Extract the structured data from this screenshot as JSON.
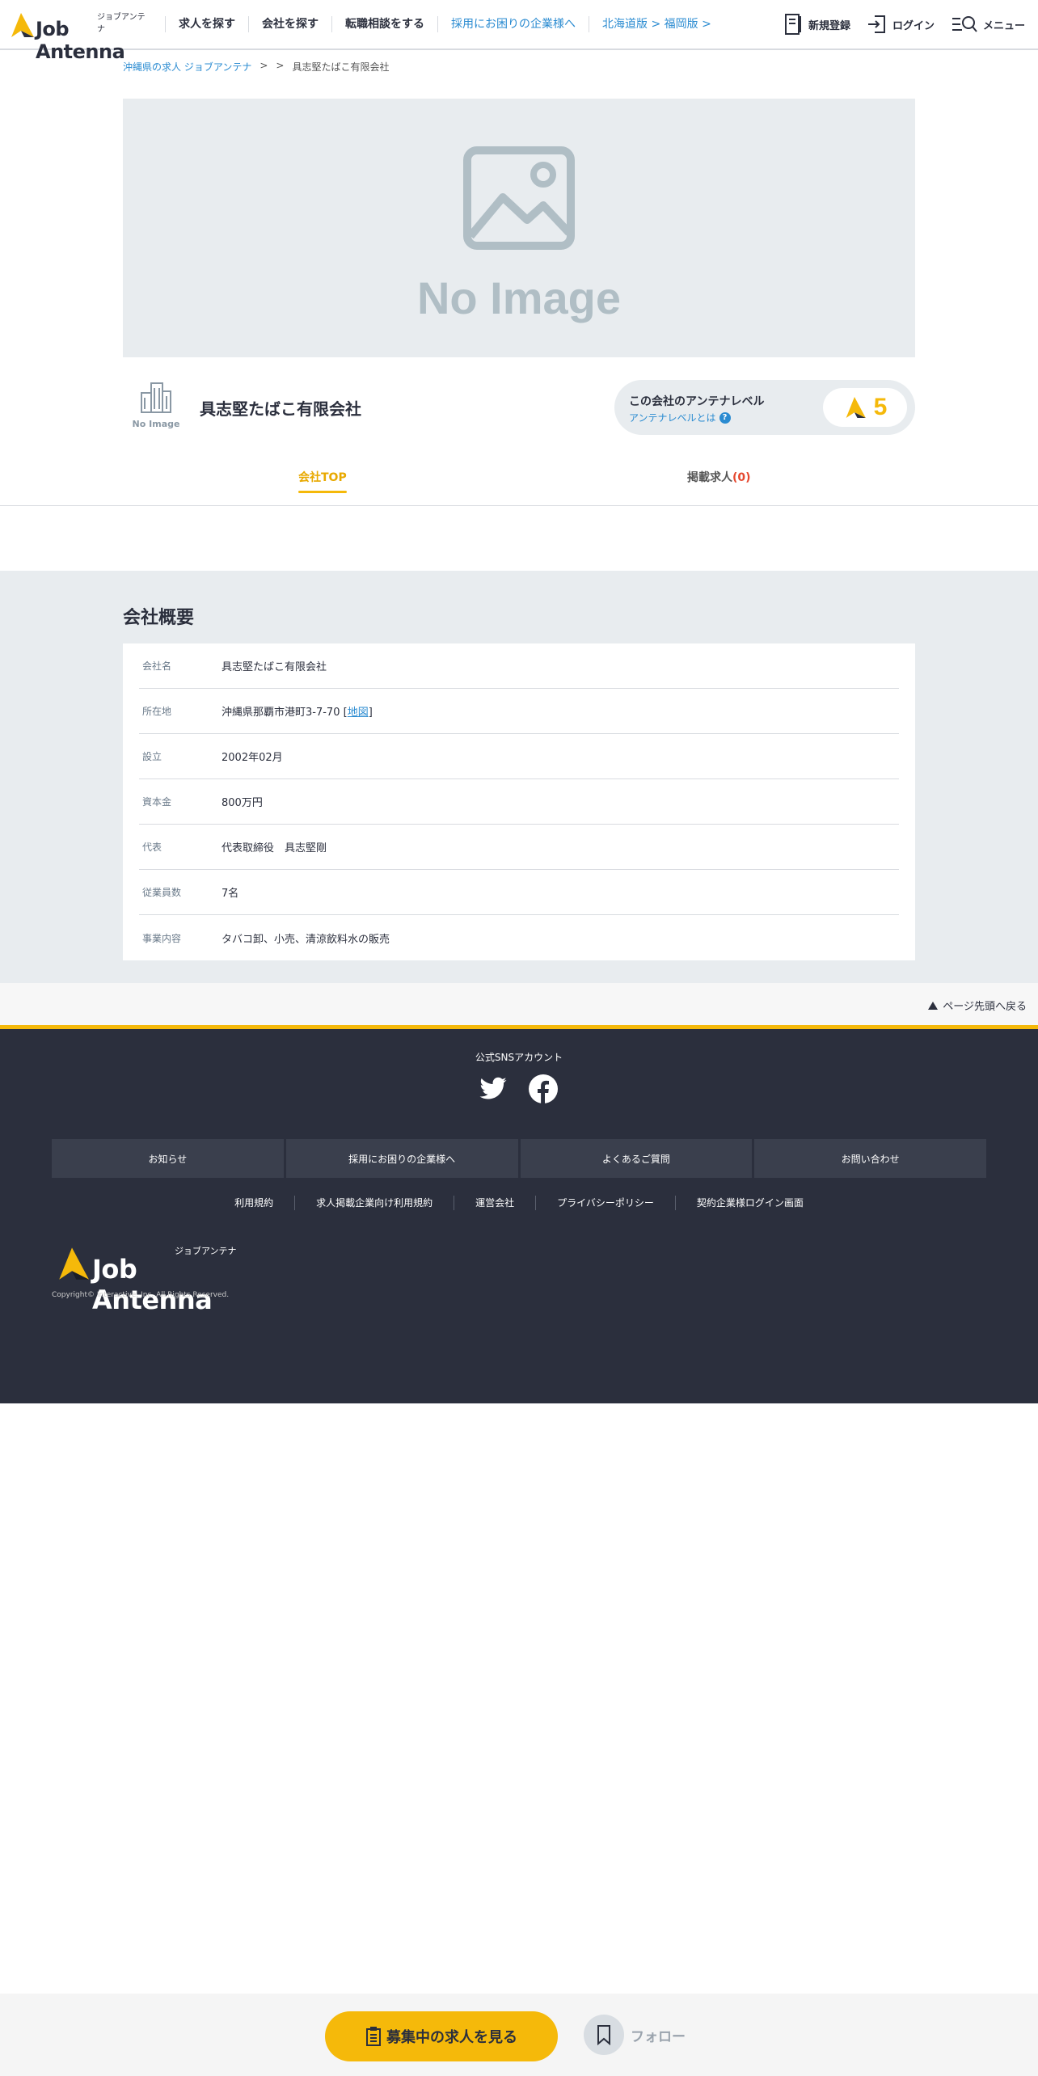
{
  "header": {
    "logo_kana": "ジョブアンテナ",
    "logo_word": "Job Antenna",
    "nav": [
      {
        "label": "求人を探す"
      },
      {
        "label": "会社を探す"
      },
      {
        "label": "転職相談をする"
      },
      {
        "label": "採用にお困りの企業様へ"
      },
      {
        "label": "北海道版 > 福岡版 >"
      }
    ],
    "register_label": "新規登録",
    "login_label": "ログイン",
    "menu_label": "メニュー"
  },
  "breadcrumb": {
    "home": "沖縄県の求人 ジョブアンテナ",
    "sep": ">",
    "current": "具志堅たばこ有限会社"
  },
  "hero": {
    "no_image_text": "No Image"
  },
  "company": {
    "logo_caption": "No Image",
    "name": "具志堅たばこ有限会社",
    "antenna_title": "この会社のアンテナレベル",
    "antenna_help": "アンテナレベルとは",
    "antenna_level": "5"
  },
  "tabs": {
    "top_label": "会社TOP",
    "jobs_label": "掲載求人",
    "jobs_count": "(0)"
  },
  "overview": {
    "title": "会社概要",
    "rows": [
      {
        "key": "会社名",
        "value": "具志堅たばこ有限会社"
      },
      {
        "key": "所在地",
        "value": "沖縄県那覇市港町3-7-70",
        "map": "地図"
      },
      {
        "key": "設立",
        "value": "2002年02月"
      },
      {
        "key": "資本金",
        "value": "800万円"
      },
      {
        "key": "代表",
        "value": "代表取締役　具志堅剛"
      },
      {
        "key": "従業員数",
        "value": "7名"
      },
      {
        "key": "事業内容",
        "value": "タバコ卸、小売、清涼飲料水の販売"
      }
    ]
  },
  "pagetop": {
    "label": "ページ先頭へ戻る"
  },
  "footer": {
    "sns_title": "公式SNSアカウント",
    "nav": [
      "お知らせ",
      "採用にお困りの企業様へ",
      "よくあるご質問",
      "お問い合わせ"
    ],
    "links": [
      "利用規約",
      "求人掲載企業向け利用規約",
      "運営会社",
      "プライバシーポリシー",
      "契約企業様ログイン画面"
    ],
    "logo_kana": "ジョブアンテナ",
    "logo_word": "Job Antenna",
    "copyright": "Copyright© Interactive, Inc. All Rights Reserved."
  },
  "bottombar": {
    "cta_label": "募集中の求人を見る",
    "follow_label": "フォロー"
  },
  "colors": {
    "accent": "#f5b90a",
    "link": "#2a8bd1",
    "footer_bg": "#2b2f3d",
    "overview_bg": "#e8ecef"
  }
}
